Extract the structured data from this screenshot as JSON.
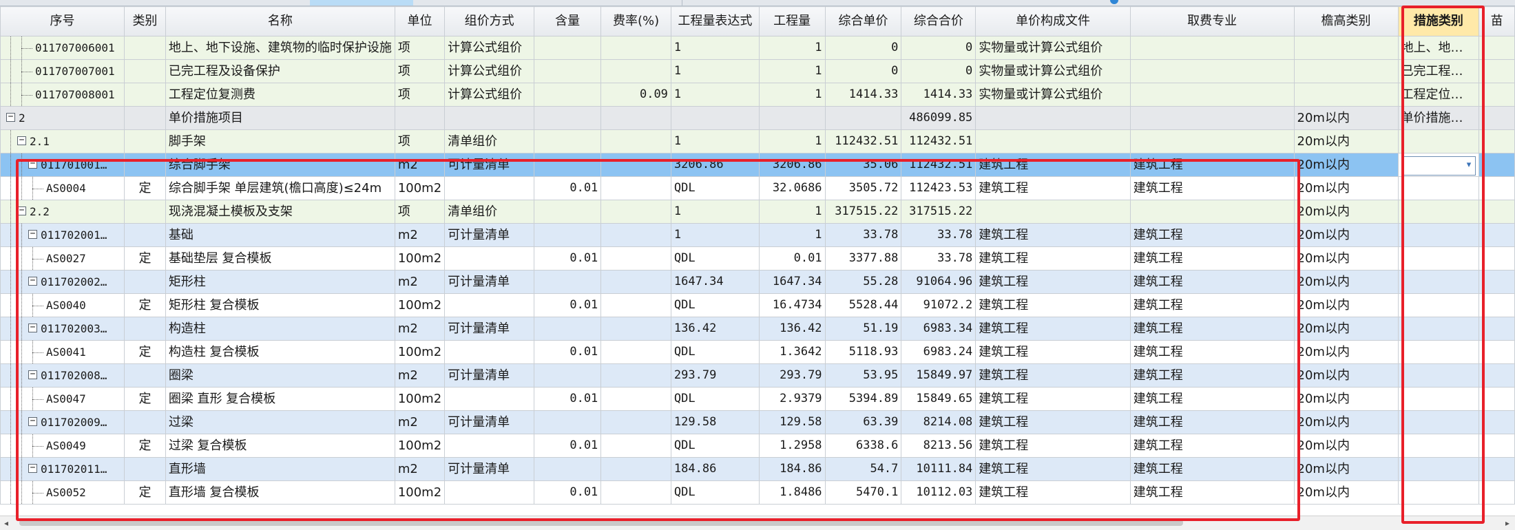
{
  "headers": [
    "序号",
    "类别",
    "名称",
    "单位",
    "组价方式",
    "含量",
    "费率(%)",
    "工程量表达式",
    "工程量",
    "综合单价",
    "综合合价",
    "单价构成文件",
    "取费专业",
    "檐高类别",
    "措施类别",
    "苗"
  ],
  "rows": [
    {
      "level": 2,
      "toggle": "",
      "code": "011707006001",
      "cat": "",
      "name": "地上、地下设施、建筑物的临时保护设施",
      "unit": "项",
      "method": "计算公式组价",
      "content": "",
      "rate": "",
      "expr": "1",
      "qty": "1",
      "price": "0",
      "total": "0",
      "file": "实物量或计算公式组价",
      "major": "",
      "height": "",
      "measure": "地上、地…",
      "style": "green"
    },
    {
      "level": 2,
      "toggle": "",
      "code": "011707007001",
      "cat": "",
      "name": "已完工程及设备保护",
      "unit": "项",
      "method": "计算公式组价",
      "content": "",
      "rate": "",
      "expr": "1",
      "qty": "1",
      "price": "0",
      "total": "0",
      "file": "实物量或计算公式组价",
      "major": "",
      "height": "",
      "measure": "已完工程…",
      "style": "green"
    },
    {
      "level": 2,
      "toggle": "",
      "code": "011707008001",
      "cat": "",
      "name": "工程定位复测费",
      "unit": "项",
      "method": "计算公式组价",
      "content": "",
      "rate": "0.09",
      "expr": "1",
      "qty": "1",
      "price": "1414.33",
      "total": "1414.33",
      "file": "实物量或计算公式组价",
      "major": "",
      "height": "",
      "measure": "工程定位…",
      "style": "green"
    },
    {
      "level": 0,
      "toggle": "−",
      "code": "2",
      "cat": "",
      "name": "单价措施项目",
      "unit": "",
      "method": "",
      "content": "",
      "rate": "",
      "expr": "",
      "qty": "",
      "price": "",
      "total": "486099.85",
      "file": "",
      "major": "",
      "height": "20m以内",
      "measure": "单价措施…",
      "style": "gray"
    },
    {
      "level": 1,
      "toggle": "−",
      "code": "2.1",
      "cat": "",
      "name": "脚手架",
      "unit": "项",
      "method": "清单组价",
      "content": "",
      "rate": "",
      "expr": "1",
      "qty": "1",
      "price": "112432.51",
      "total": "112432.51",
      "file": "",
      "major": "",
      "height": "20m以内",
      "measure": "",
      "style": "green"
    },
    {
      "level": 2,
      "toggle": "−",
      "code": "011701001…",
      "cat": "",
      "name": "综合脚手架",
      "unit": "m2",
      "method": "可计量清单",
      "content": "",
      "rate": "",
      "expr": "3206.86",
      "qty": "3206.86",
      "price": "35.06",
      "total": "112432.51",
      "file": "建筑工程",
      "major": "建筑工程",
      "height": "20m以内",
      "measure": "",
      "style": "sel",
      "dropdown": true
    },
    {
      "level": 3,
      "toggle": "",
      "code": "AS0004",
      "cat": "定",
      "name": "综合脚手架 单层建筑(檐口高度)≤24m",
      "unit": "100m2",
      "method": "",
      "content": "0.01",
      "rate": "",
      "expr": "QDL",
      "qty": "32.0686",
      "price": "3505.72",
      "total": "112423.53",
      "file": "建筑工程",
      "major": "建筑工程",
      "height": "20m以内",
      "measure": "",
      "style": "white"
    },
    {
      "level": 1,
      "toggle": "−",
      "code": "2.2",
      "cat": "",
      "name": "现浇混凝土模板及支架",
      "unit": "项",
      "method": "清单组价",
      "content": "",
      "rate": "",
      "expr": "1",
      "qty": "1",
      "price": "317515.22",
      "total": "317515.22",
      "file": "",
      "major": "",
      "height": "20m以内",
      "measure": "",
      "style": "green"
    },
    {
      "level": 2,
      "toggle": "−",
      "code": "011702001…",
      "cat": "",
      "name": "基础",
      "unit": "m2",
      "method": "可计量清单",
      "content": "",
      "rate": "",
      "expr": "1",
      "qty": "1",
      "price": "33.78",
      "total": "33.78",
      "file": "建筑工程",
      "major": "建筑工程",
      "height": "20m以内",
      "measure": "",
      "style": "blue"
    },
    {
      "level": 3,
      "toggle": "",
      "code": "AS0027",
      "cat": "定",
      "name": "基础垫层 复合模板",
      "unit": "100m2",
      "method": "",
      "content": "0.01",
      "rate": "",
      "expr": "QDL",
      "qty": "0.01",
      "price": "3377.88",
      "total": "33.78",
      "file": "建筑工程",
      "major": "建筑工程",
      "height": "20m以内",
      "measure": "",
      "style": "white"
    },
    {
      "level": 2,
      "toggle": "−",
      "code": "011702002…",
      "cat": "",
      "name": "矩形柱",
      "unit": "m2",
      "method": "可计量清单",
      "content": "",
      "rate": "",
      "expr": "1647.34",
      "qty": "1647.34",
      "price": "55.28",
      "total": "91064.96",
      "file": "建筑工程",
      "major": "建筑工程",
      "height": "20m以内",
      "measure": "",
      "style": "blue"
    },
    {
      "level": 3,
      "toggle": "",
      "code": "AS0040",
      "cat": "定",
      "name": "矩形柱 复合模板",
      "unit": "100m2",
      "method": "",
      "content": "0.01",
      "rate": "",
      "expr": "QDL",
      "qty": "16.4734",
      "price": "5528.44",
      "total": "91072.2",
      "file": "建筑工程",
      "major": "建筑工程",
      "height": "20m以内",
      "measure": "",
      "style": "white"
    },
    {
      "level": 2,
      "toggle": "−",
      "code": "011702003…",
      "cat": "",
      "name": "构造柱",
      "unit": "m2",
      "method": "可计量清单",
      "content": "",
      "rate": "",
      "expr": "136.42",
      "qty": "136.42",
      "price": "51.19",
      "total": "6983.34",
      "file": "建筑工程",
      "major": "建筑工程",
      "height": "20m以内",
      "measure": "",
      "style": "blue"
    },
    {
      "level": 3,
      "toggle": "",
      "code": "AS0041",
      "cat": "定",
      "name": "构造柱 复合模板",
      "unit": "100m2",
      "method": "",
      "content": "0.01",
      "rate": "",
      "expr": "QDL",
      "qty": "1.3642",
      "price": "5118.93",
      "total": "6983.24",
      "file": "建筑工程",
      "major": "建筑工程",
      "height": "20m以内",
      "measure": "",
      "style": "white"
    },
    {
      "level": 2,
      "toggle": "−",
      "code": "011702008…",
      "cat": "",
      "name": "圈梁",
      "unit": "m2",
      "method": "可计量清单",
      "content": "",
      "rate": "",
      "expr": "293.79",
      "qty": "293.79",
      "price": "53.95",
      "total": "15849.97",
      "file": "建筑工程",
      "major": "建筑工程",
      "height": "20m以内",
      "measure": "",
      "style": "blue"
    },
    {
      "level": 3,
      "toggle": "",
      "code": "AS0047",
      "cat": "定",
      "name": "圈梁 直形 复合模板",
      "unit": "100m2",
      "method": "",
      "content": "0.01",
      "rate": "",
      "expr": "QDL",
      "qty": "2.9379",
      "price": "5394.89",
      "total": "15849.65",
      "file": "建筑工程",
      "major": "建筑工程",
      "height": "20m以内",
      "measure": "",
      "style": "white"
    },
    {
      "level": 2,
      "toggle": "−",
      "code": "011702009…",
      "cat": "",
      "name": "过梁",
      "unit": "m2",
      "method": "可计量清单",
      "content": "",
      "rate": "",
      "expr": "129.58",
      "qty": "129.58",
      "price": "63.39",
      "total": "8214.08",
      "file": "建筑工程",
      "major": "建筑工程",
      "height": "20m以内",
      "measure": "",
      "style": "blue"
    },
    {
      "level": 3,
      "toggle": "",
      "code": "AS0049",
      "cat": "定",
      "name": "过梁 复合模板",
      "unit": "100m2",
      "method": "",
      "content": "0.01",
      "rate": "",
      "expr": "QDL",
      "qty": "1.2958",
      "price": "6338.6",
      "total": "8213.56",
      "file": "建筑工程",
      "major": "建筑工程",
      "height": "20m以内",
      "measure": "",
      "style": "white"
    },
    {
      "level": 2,
      "toggle": "−",
      "code": "011702011…",
      "cat": "",
      "name": "直形墙",
      "unit": "m2",
      "method": "可计量清单",
      "content": "",
      "rate": "",
      "expr": "184.86",
      "qty": "184.86",
      "price": "54.7",
      "total": "10111.84",
      "file": "建筑工程",
      "major": "建筑工程",
      "height": "20m以内",
      "measure": "",
      "style": "blue"
    },
    {
      "level": 3,
      "toggle": "",
      "code": "AS0052",
      "cat": "定",
      "name": "直形墙 复合模板",
      "unit": "100m2",
      "method": "",
      "content": "0.01",
      "rate": "",
      "expr": "QDL",
      "qty": "1.8486",
      "price": "5470.1",
      "total": "10112.03",
      "file": "建筑工程",
      "major": "建筑工程",
      "height": "20m以内",
      "measure": "",
      "style": "white"
    }
  ],
  "scroll": {
    "left_arrow": "◂",
    "right_arrow": "▸"
  },
  "dropdown_arrow": "▾"
}
